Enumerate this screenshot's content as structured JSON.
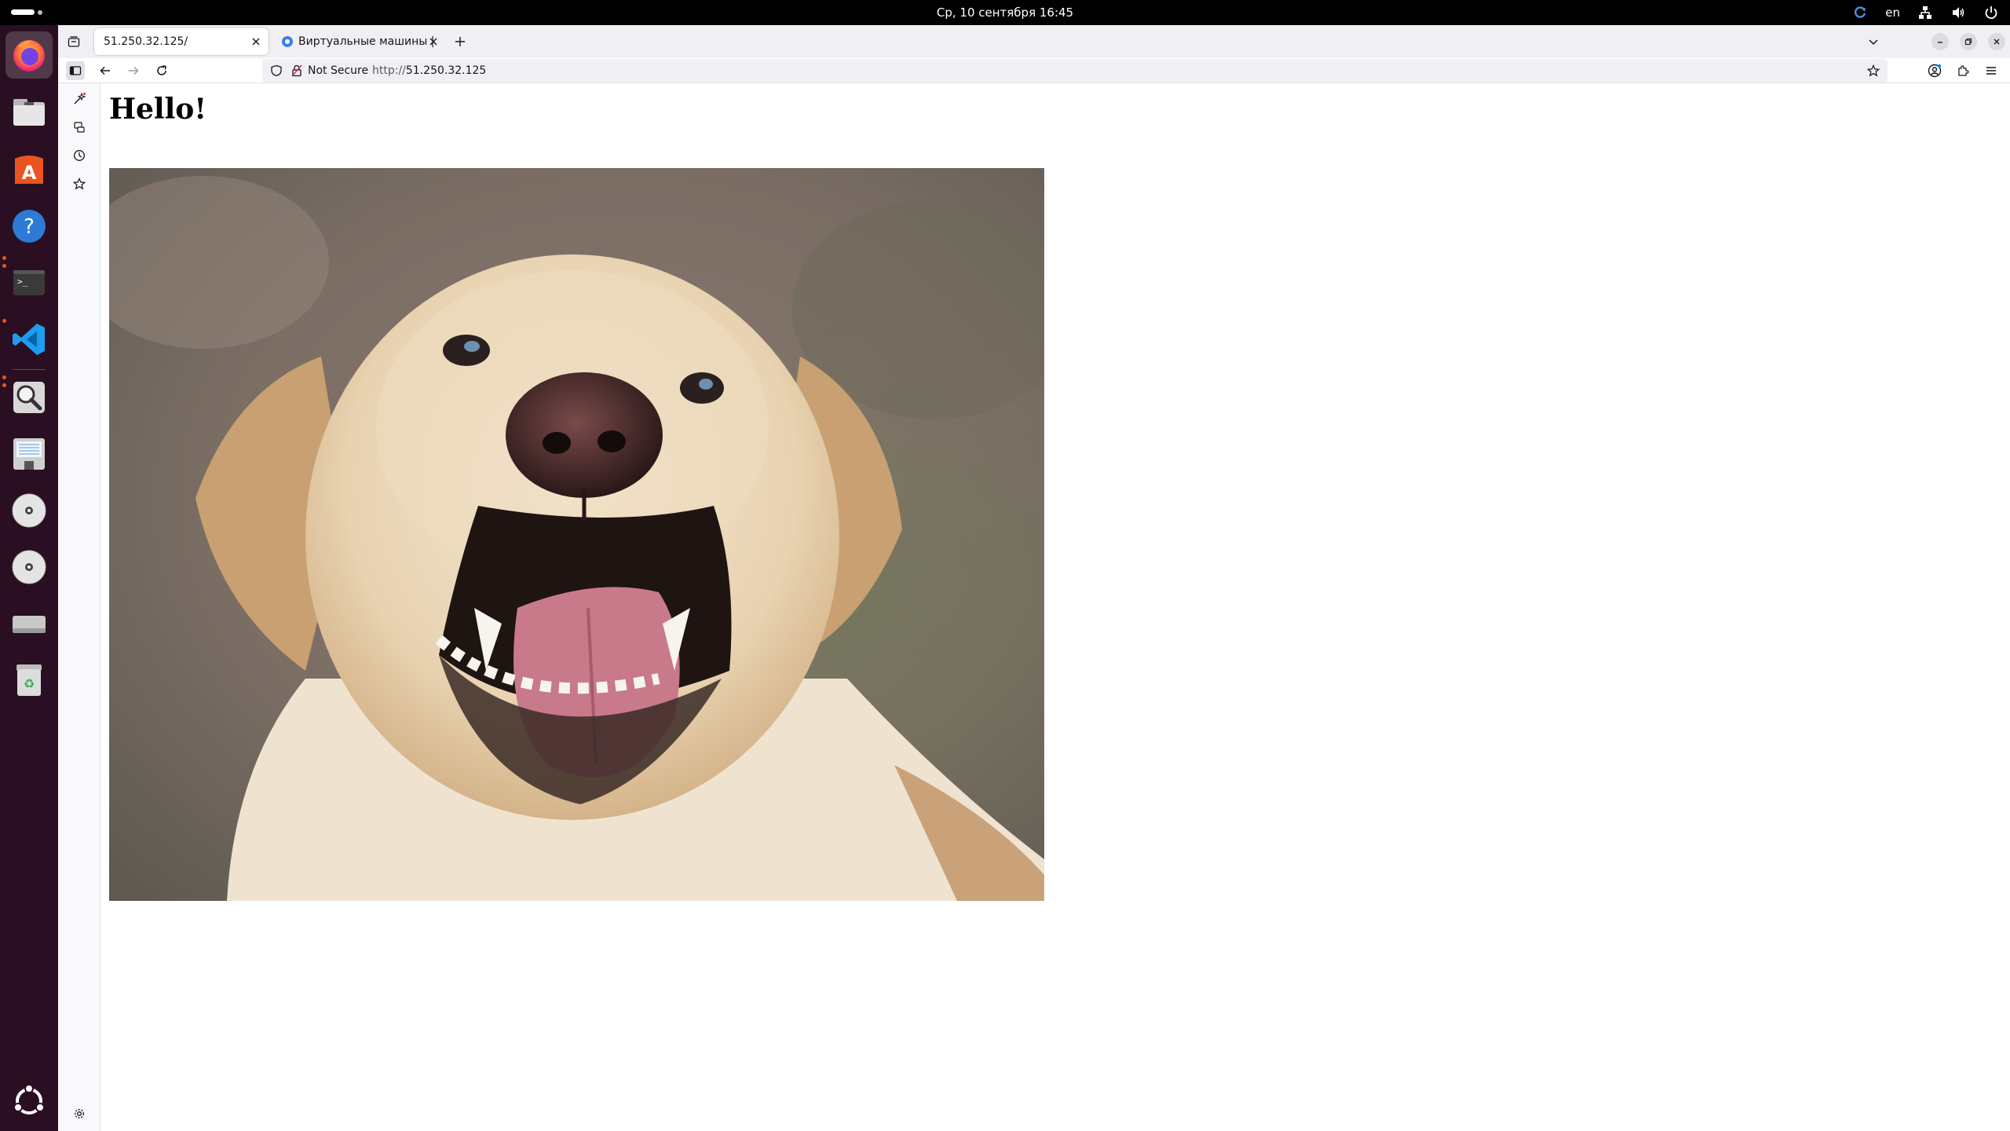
{
  "topbar": {
    "clock": "Ср, 10 сентября  16:45",
    "language": "en"
  },
  "dock": {
    "items": [
      {
        "name": "firefox",
        "active": true,
        "running": false
      },
      {
        "name": "files",
        "running": false
      },
      {
        "name": "app-center",
        "running": false
      },
      {
        "name": "help",
        "running": false
      },
      {
        "name": "terminal",
        "running": true
      },
      {
        "name": "vscode",
        "running": true
      },
      {
        "name": "image-viewer",
        "running": true
      },
      {
        "name": "floppy",
        "running": false
      },
      {
        "name": "optical-disc-1",
        "running": false
      },
      {
        "name": "optical-disc-2",
        "running": false
      },
      {
        "name": "drive",
        "running": false
      },
      {
        "name": "trash",
        "running": false
      }
    ]
  },
  "browser": {
    "tabs": [
      {
        "title": "51.250.32.125/",
        "selected": true
      },
      {
        "title": "Виртуальные машины |",
        "selected": false
      }
    ],
    "security_label": "Not Secure",
    "url_scheme": "http://",
    "url_host": "51.250.32.125"
  },
  "page": {
    "heading": "Hello!",
    "image_alt": "dog"
  },
  "colors": {
    "accent": "#e95420",
    "dock_bg": "#2a0f22",
    "tabstrip_bg": "#f0f0f4"
  }
}
